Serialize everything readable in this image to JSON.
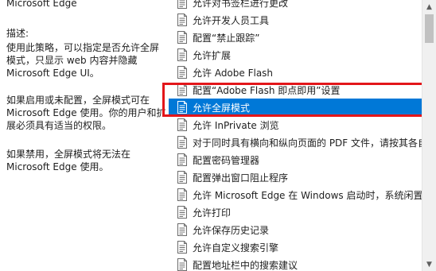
{
  "description": {
    "lines": [
      "Microsoft Edge",
      "描述:",
      "使用此策略，可以指定是否允许全屏",
      "模式，只显示 web 内容并隐藏",
      "Microsoft Edge UI。",
      "如果启用或未配置，全屏模式可在",
      "Microsoft Edge 使用。你的用户和扩",
      "展必须具有适当的权限。",
      "如果禁用，全屏模式将无法在",
      "Microsoft Edge 使用。"
    ]
  },
  "policy_list": {
    "items": [
      {
        "label": "允许对书签栏进行更改"
      },
      {
        "label": "允许开发人员工具"
      },
      {
        "label": "配置“禁止跟踪”"
      },
      {
        "label": "允许扩展"
      },
      {
        "label": "允许 Adobe Flash"
      },
      {
        "label": "配置“Adobe Flash 即点即用”设置"
      },
      {
        "label": "允许全屏模式",
        "selected": true
      },
      {
        "label": "允许 InPrivate 浏览"
      },
      {
        "label": "对于同时具有横向和纵向页面的 PDF 文件，请按其各自"
      },
      {
        "label": "配置密码管理器"
      },
      {
        "label": "配置弹出窗口阻止程序"
      },
      {
        "label": "允许 Microsoft Edge 在 Windows 启动时，系统闲置"
      },
      {
        "label": "允许打印"
      },
      {
        "label": "允许保存历史记录"
      },
      {
        "label": "允许自定义搜索引擎"
      },
      {
        "label": "配置地址栏中的搜索建议"
      }
    ]
  },
  "colors": {
    "selection": "#0078d7",
    "highlight_border": "#e3161a"
  },
  "icons": {
    "policy_item": "policy-setting-icon",
    "scroll_up": "▲",
    "scroll_down": "▼"
  }
}
